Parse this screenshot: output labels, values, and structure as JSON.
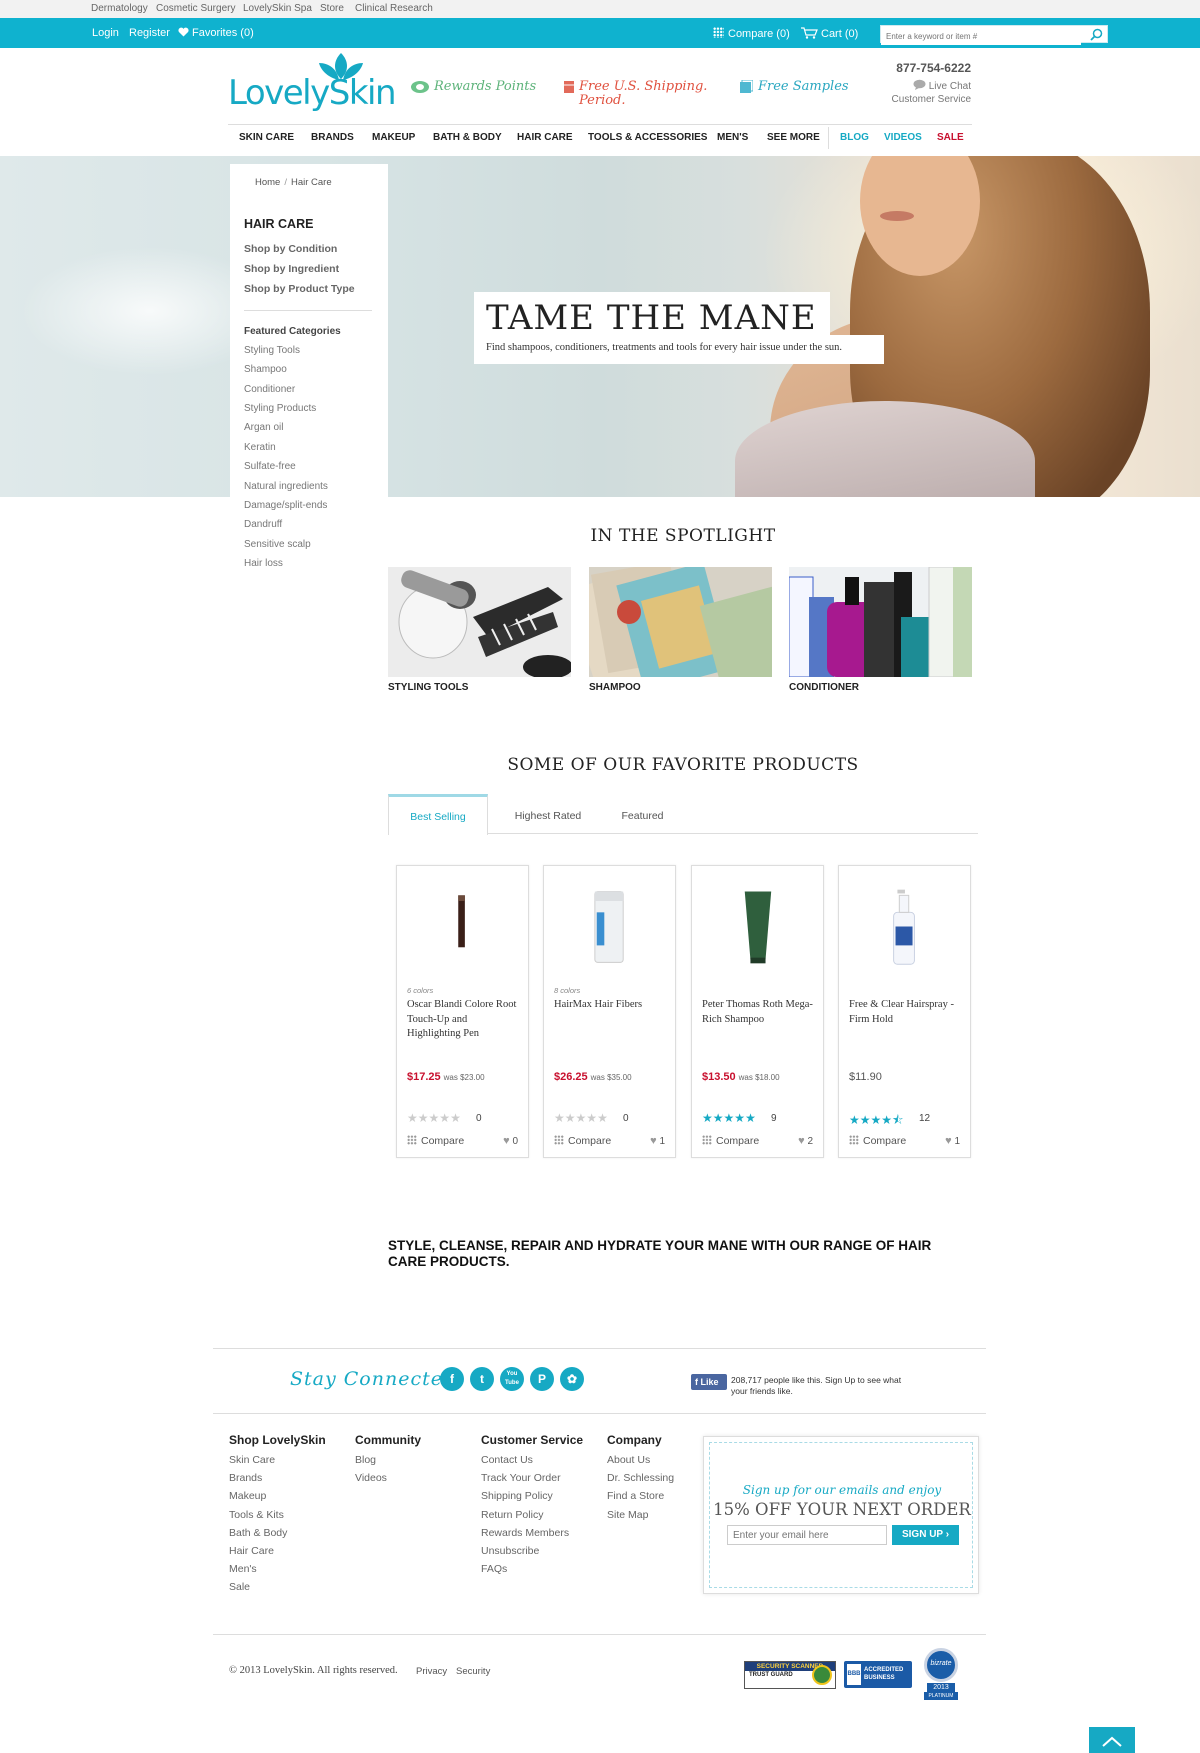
{
  "utility_links": [
    "Dermatology",
    "Cosmetic Surgery",
    "LovelySkin Spa",
    "Store",
    "Clinical Research"
  ],
  "account": {
    "login": "Login",
    "register": "Register",
    "favorites": "Favorites (0)",
    "compare": "Compare (0)",
    "cart": "Cart (0)"
  },
  "search": {
    "placeholder": "Enter a keyword or item #"
  },
  "header": {
    "logo": "LovelySkin",
    "promo_rewards": "Rewards Points",
    "promo_shipping_1": "Free U.S. Shipping.",
    "promo_shipping_2": "Period.",
    "promo_samples": "Free Samples",
    "phone": "877-754-6222",
    "live_chat": "Live Chat",
    "customer_service": "Customer Service"
  },
  "nav": [
    "SKIN CARE",
    "BRANDS",
    "MAKEUP",
    "BATH & BODY",
    "HAIR CARE",
    "TOOLS & ACCESSORIES",
    "MEN'S",
    "SEE MORE",
    "BLOG",
    "VIDEOS",
    "SALE"
  ],
  "colors": {
    "accent": "#0fb2cf",
    "sale": "#c8102e",
    "price": "#c8102e"
  },
  "hero": {
    "title": "TAME THE MANE",
    "subtitle": "Find shampoos, conditioners, treatments and tools for every hair issue under the sun."
  },
  "sidebar": {
    "breadcrumb": [
      "Home",
      "Hair Care"
    ],
    "heading": "HAIR CARE",
    "shop_by": [
      "Shop by Condition",
      "Shop by Ingredient",
      "Shop by Product Type"
    ],
    "featured_heading": "Featured Categories",
    "featured": [
      "Styling Tools",
      "Shampoo",
      "Conditioner",
      "Styling Products",
      "Argan oil",
      "Keratin",
      "Sulfate-free",
      "Natural ingredients",
      "Damage/split-ends",
      "Dandruff",
      "Sensitive scalp",
      "Hair loss"
    ]
  },
  "spotlight": {
    "title": "IN THE SPOTLIGHT",
    "items": [
      "STYLING TOOLS",
      "SHAMPOO",
      "CONDITIONER"
    ]
  },
  "favorites": {
    "title": "SOME OF OUR FAVORITE PRODUCTS",
    "tabs": [
      "Best Selling",
      "Highest Rated",
      "Featured"
    ],
    "compare_label": "Compare",
    "products": [
      {
        "colors": "6 colors",
        "name": "Oscar Blandi Colore Root Touch-Up and Highlighting Pen",
        "price": "$17.25",
        "was": "was $23.00",
        "rating": 0,
        "reviews": "0",
        "favs": "0"
      },
      {
        "colors": "8 colors",
        "name": "HairMax Hair Fibers",
        "price": "$26.25",
        "was": "was $35.00",
        "rating": 0,
        "reviews": "0",
        "favs": "1"
      },
      {
        "colors": "",
        "name": "Peter Thomas Roth Mega-Rich Shampoo",
        "price": "$13.50",
        "was": "was $18.00",
        "rating": 5,
        "reviews": "9",
        "favs": "2"
      },
      {
        "colors": "",
        "name": "Free & Clear Hairspray - Firm Hold",
        "price": "$11.90",
        "was": "",
        "rating": 4.5,
        "reviews": "12",
        "favs": "1"
      }
    ]
  },
  "tagline": "STYLE, CLEANSE, REPAIR AND HYDRATE YOUR MANE WITH OUR RANGE OF HAIR CARE PRODUCTS.",
  "footer": {
    "stay_connected": "Stay Connected",
    "social": [
      "f",
      "t",
      "You Tube",
      "P",
      "✿"
    ],
    "fb_like": "Like",
    "fb_text": "208,717 people like this. Sign Up to see what your friends like.",
    "columns": [
      {
        "heading": "Shop LovelySkin",
        "items": [
          "Skin Care",
          "Brands",
          "Makeup",
          "Tools & Kits",
          "Bath & Body",
          "Hair Care",
          "Men's",
          "Sale"
        ]
      },
      {
        "heading": "Community",
        "items": [
          "Blog",
          "Videos"
        ]
      },
      {
        "heading": "Customer Service",
        "items": [
          "Contact Us",
          "Track Your Order",
          "Shipping Policy",
          "Return Policy",
          "Rewards Members",
          "Unsubscribe",
          "FAQs"
        ]
      },
      {
        "heading": "Company",
        "items": [
          "About Us",
          "Dr. Schlessing",
          "Find a Store",
          "Site Map"
        ]
      }
    ],
    "signup_line1": "Sign up for our emails and enjoy",
    "signup_line2": "15% OFF YOUR NEXT ORDER",
    "signup_placeholder": "Enter your email here",
    "signup_button": "SIGN UP",
    "copyright": "© 2013 LovelySkin. All rights reserved.",
    "links": [
      "Privacy",
      "Security"
    ],
    "badges": {
      "security": "SECURITY SCANNED",
      "trust": "TRUST GUARD",
      "bbb": "ACCREDITED BUSINESS",
      "bizrate": "bizrate",
      "bizrate_year": "2013",
      "bizrate_level": "PLATINUM"
    }
  }
}
